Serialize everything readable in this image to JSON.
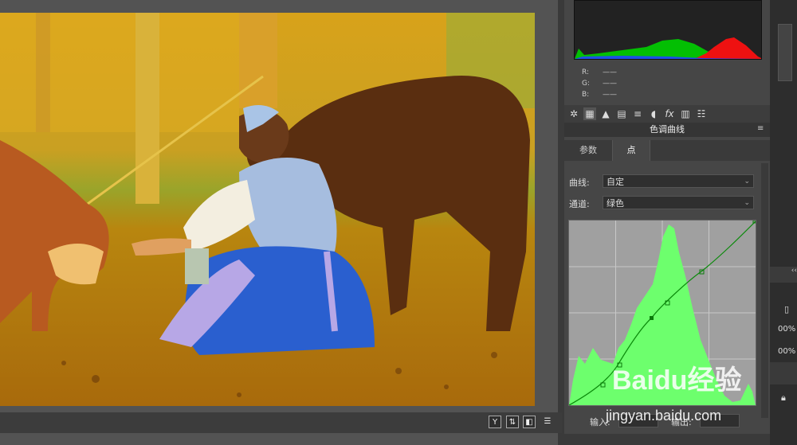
{
  "histogram": {
    "channels": [
      {
        "label": "R:",
        "value": "——"
      },
      {
        "label": "G:",
        "value": "——"
      },
      {
        "label": "B:",
        "value": "——"
      }
    ]
  },
  "adjustments": {
    "toolbar_icons": [
      "aperture-icon",
      "grid-icon",
      "levels-icon",
      "layers-icon",
      "stripes-icon",
      "waveform-icon",
      "fx-icon",
      "film-icon",
      "sliders-icon"
    ],
    "panel_title": "色调曲线",
    "tabs": [
      {
        "label": "参数",
        "active": false
      },
      {
        "label": "点",
        "active": true
      }
    ],
    "curve_label": "曲线:",
    "curve_value": "自定",
    "channel_label": "通道:",
    "channel_value": "绿色",
    "input_label": "输入:",
    "output_label": "输出:"
  },
  "right_edge": {
    "pct1": "00%",
    "pct2": "00%"
  },
  "watermark": {
    "brand": "Baidu经验",
    "url": "jingyan.baidu.com"
  },
  "status_bar": {
    "y_button": "Y",
    "colors": {
      "panel": "#464646",
      "curve_green": "#00d000",
      "histogram_green": "#66ff66"
    }
  }
}
